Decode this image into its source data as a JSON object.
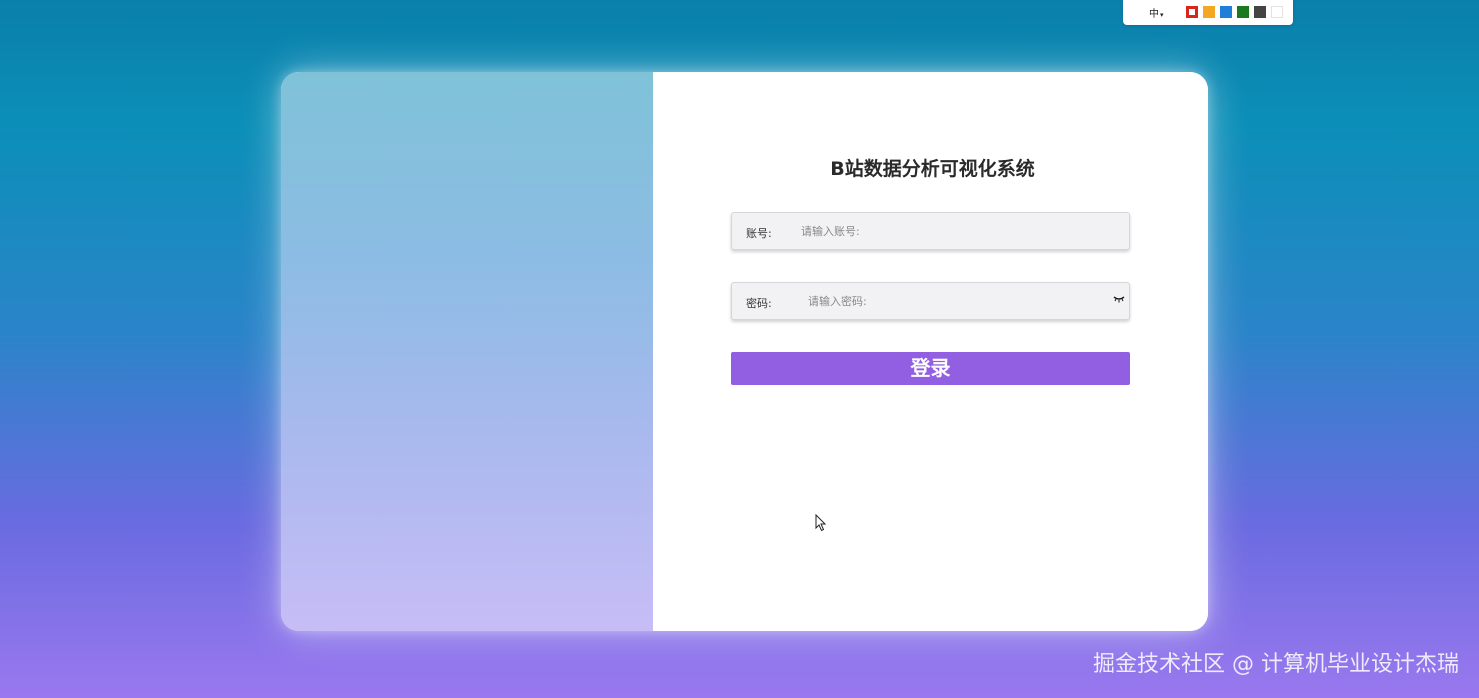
{
  "toolbar": {
    "language_label": "中",
    "language_caret": "▾",
    "theme_swatches": [
      {
        "name": "red",
        "color": "#d9261c",
        "selected": true
      },
      {
        "name": "orange",
        "color": "#f5a623"
      },
      {
        "name": "blue",
        "color": "#1e7fd6"
      },
      {
        "name": "green",
        "color": "#1a7a1f"
      },
      {
        "name": "dark-gray",
        "color": "#444444"
      },
      {
        "name": "white",
        "color": "#ffffff"
      }
    ]
  },
  "login": {
    "title": "B站数据分析可视化系统",
    "account_label": "账号:",
    "account_placeholder": "请输入账号:",
    "password_label": "密码:",
    "password_placeholder": "请输入密码:",
    "submit_label": "登录",
    "button_color": "#925fe2"
  },
  "watermark": "掘金技术社区 @ 计算机毕业设计杰瑞"
}
